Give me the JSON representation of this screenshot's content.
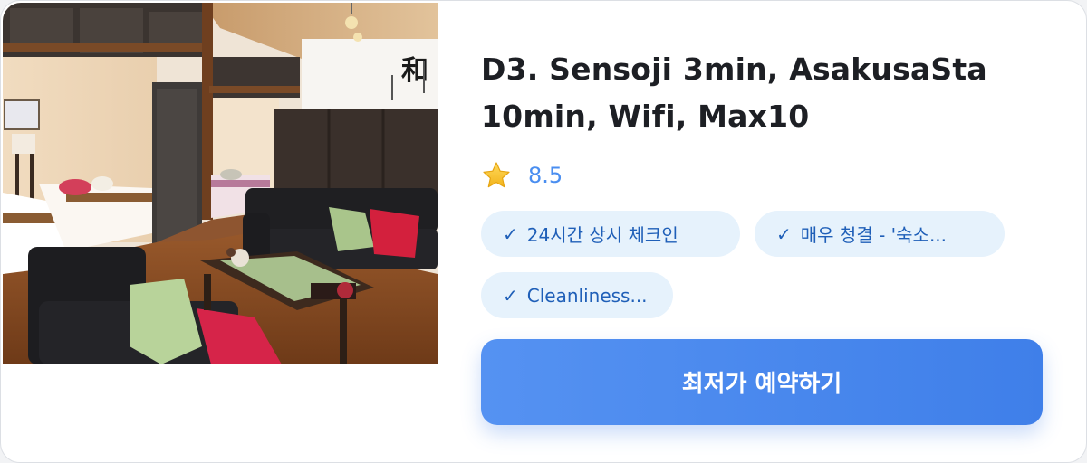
{
  "listing": {
    "title_line1": "D3. Sensoji 3min, AsakusaSta",
    "title_line2": "10min, Wifi, Max10",
    "rating": "8.5",
    "tags": [
      "24시간 상시 체크인",
      "매우 청결 - '숙소...",
      "Cleanliness..."
    ],
    "tag_check": "✓",
    "book_button_label": "최저가 예약하기",
    "photo_calligraphy": "和",
    "icon": "star-icon",
    "colors": {
      "accent": "#4a8ef0",
      "tag_bg": "#e6f2fc",
      "tag_text": "#1f5fb8",
      "button_start": "#5592f2",
      "button_end": "#3f7fe9",
      "star": "#f7c531"
    }
  }
}
